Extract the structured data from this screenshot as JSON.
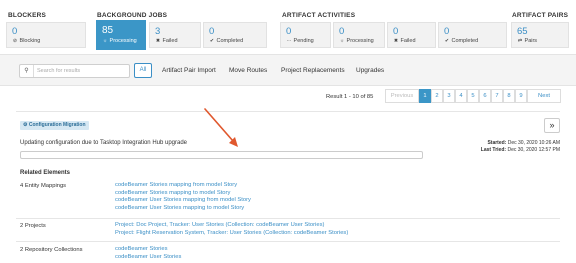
{
  "summary": {
    "blockers": {
      "title": "BLOCKERS",
      "items": [
        {
          "count": "0",
          "label": "Blocking",
          "icon": "ban-icon"
        }
      ]
    },
    "background_jobs": {
      "title": "BACKGROUND JOBS",
      "items": [
        {
          "count": "85",
          "label": "Processing",
          "icon": "spinner-icon"
        },
        {
          "count": "3",
          "label": "Failed",
          "icon": "x-circle-icon"
        },
        {
          "count": "0",
          "label": "Completed",
          "icon": "check-circle-icon"
        }
      ]
    },
    "artifact_activities": {
      "title": "ARTIFACT ACTIVITIES",
      "items": [
        {
          "count": "0",
          "label": "Pending",
          "icon": "ellipsis-icon"
        },
        {
          "count": "0",
          "label": "Processing",
          "icon": "spinner-icon"
        },
        {
          "count": "0",
          "label": "Failed",
          "icon": "x-circle-icon"
        },
        {
          "count": "0",
          "label": "Completed",
          "icon": "check-circle-icon"
        }
      ]
    },
    "artifact_pairs": {
      "title": "ARTIFACT PAIRS",
      "items": [
        {
          "count": "65",
          "label": "Pairs",
          "icon": "pairs-icon"
        }
      ]
    }
  },
  "toolbar": {
    "search_placeholder": "Search for results",
    "all_label": "All",
    "nav": [
      "Artifact Pair Import",
      "Move Routes",
      "Project Replacements",
      "Upgrades"
    ]
  },
  "pagination": {
    "result_text": "Result 1 - 10 of 85",
    "previous": "Previous",
    "pages": [
      "1",
      "2",
      "3",
      "4",
      "5",
      "6",
      "7",
      "8",
      "9"
    ],
    "current": "1",
    "next": "Next"
  },
  "job": {
    "badge": "⚙ Configuration Migration",
    "expand": "»",
    "description": "Updating configuration due to Tasktop Integration Hub upgrade",
    "started_label": "Started:",
    "started_value": "Dec 30, 2020 10:26 AM",
    "last_tried_label": "Last Tried:",
    "last_tried_value": "Dec 30, 2020 12:57 PM",
    "progress": 0
  },
  "related": {
    "title": "Related Elements",
    "rows": [
      {
        "label": "4 Entity Mappings",
        "links": [
          "codeBeamer Stories mapping from model Story",
          "codeBeamer Stories mapping to model Story",
          "codeBeamer User Stories mapping from model Story",
          "codeBeamer User Stories mapping to model Story"
        ]
      },
      {
        "label": "2 Projects",
        "links": [
          "Project: Doc Project, Tracker: User Stories (Collection: codeBeamer User Stories)",
          "Project: Flight Reservation System, Tracker: User Stories (Collection: codeBeamer Stories)"
        ]
      },
      {
        "label": "2 Repository Collections",
        "links": [
          "codeBeamer Stories",
          "codeBeamer User Stories"
        ]
      }
    ]
  },
  "colors": {
    "accent": "#3b96c7",
    "link": "#3b8fc6",
    "annotation_arrow": "#e0582e"
  }
}
